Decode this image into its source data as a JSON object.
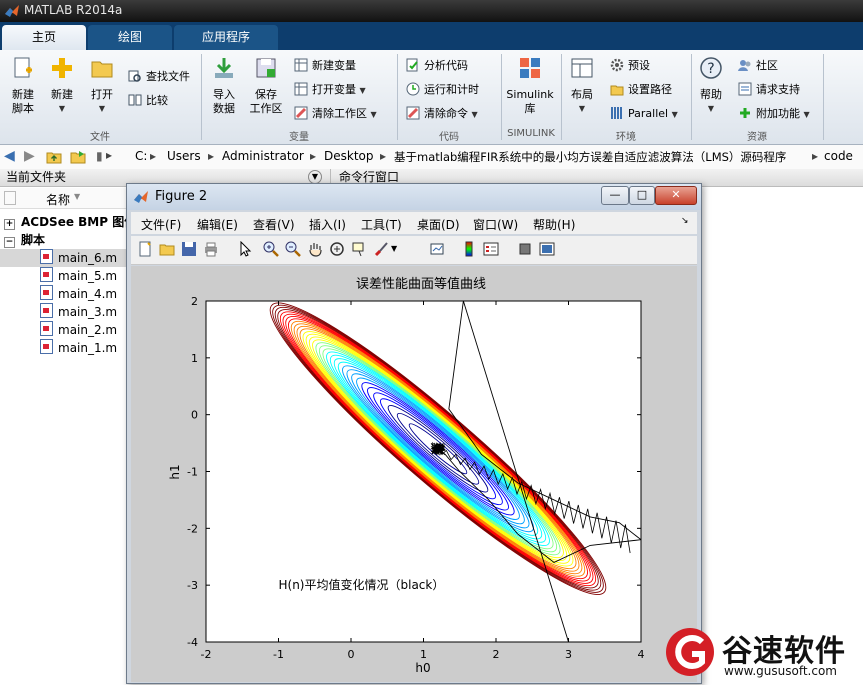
{
  "app": {
    "title": "MATLAB R2014a"
  },
  "tabs": [
    {
      "label": "主页"
    },
    {
      "label": "绘图"
    },
    {
      "label": "应用程序"
    }
  ],
  "ribbon": {
    "file": {
      "new_script": "新建\n脚本",
      "new": "新建",
      "open": "打开",
      "find_files": "查找文件",
      "compare": "比较",
      "section": "文件"
    },
    "variable": {
      "import": "导入\n数据",
      "save_ws": "保存\n工作区",
      "new_var": "新建变量",
      "open_var": "打开变量",
      "clear_ws": "清除工作区",
      "section": "变量"
    },
    "code": {
      "analyze": "分析代码",
      "run_time": "运行和计时",
      "clear_cmd": "清除命令",
      "section": "代码"
    },
    "simulink": {
      "lib": "Simulink\n库",
      "section": "SIMULINK"
    },
    "env": {
      "layout": "布局",
      "prefs": "预设",
      "set_path": "设置路径",
      "parallel": "Parallel",
      "section": "环境"
    },
    "resources": {
      "help": "帮助",
      "community": "社区",
      "request_support": "请求支持",
      "addons": "附加功能",
      "section": "资源"
    }
  },
  "address": {
    "crumbs": [
      "C:",
      "Users",
      "Administrator",
      "Desktop",
      "基于matlab编程FIR系统中的最小均方误差自适应滤波算法（LMS）源码程序",
      "code"
    ]
  },
  "left_panel": {
    "title": "当前文件夹",
    "column_name": "名称",
    "group1": "ACDSee BMP 图像",
    "group2": "脚本",
    "files": [
      "main_6.m",
      "main_5.m",
      "main_4.m",
      "main_3.m",
      "main_2.m",
      "main_1.m"
    ]
  },
  "cmd_panel": {
    "title": "命令行窗口"
  },
  "figure": {
    "title": "Figure 2",
    "menu": [
      "文件(F)",
      "编辑(E)",
      "查看(V)",
      "插入(I)",
      "工具(T)",
      "桌面(D)",
      "窗口(W)",
      "帮助(H)"
    ],
    "win_buttons": {
      "min": "—",
      "max": "□",
      "close": "✕"
    }
  },
  "chart_data": {
    "type": "contour",
    "title": "误差性能曲面等值曲线",
    "xlabel": "h0",
    "ylabel": "h1",
    "xlim": [
      -2,
      4
    ],
    "ylim": [
      -4,
      2
    ],
    "xticks": [
      -2,
      -1,
      0,
      1,
      2,
      3,
      4
    ],
    "yticks": [
      -4,
      -3,
      -2,
      -1,
      0,
      1,
      2
    ],
    "annotation": {
      "text": "H(n)平均值变化情况（black）",
      "x": -1.0,
      "y": -3.0
    },
    "contour_center": [
      1.2,
      -0.6
    ],
    "contour_major_direction": [
      1,
      -1.1
    ],
    "colormap": [
      "#00008f",
      "#0000ff",
      "#00a0ff",
      "#00ffff",
      "#80ff80",
      "#ffff00",
      "#ff8000",
      "#ff0000",
      "#800000"
    ],
    "trajectory_path": [
      [
        1.55,
        2.0
      ],
      [
        1.35,
        0.1
      ],
      [
        1.8,
        -0.7
      ],
      [
        2.3,
        -1.2
      ],
      [
        2.8,
        -1.5
      ],
      [
        3.3,
        -1.8
      ],
      [
        3.7,
        -1.9
      ],
      [
        4.0,
        -2.2
      ],
      [
        3.3,
        -2.3
      ],
      [
        2.8,
        -2.6
      ],
      [
        2.3,
        -2.1
      ],
      [
        1.9,
        -1.5
      ],
      [
        1.5,
        -1.0
      ],
      [
        1.3,
        -0.7
      ],
      [
        1.2,
        -0.6
      ]
    ],
    "trajectory_line": [
      [
        1.55,
        2.0
      ],
      [
        3.0,
        -4.0
      ]
    ],
    "trajectory_color": "#000000"
  },
  "watermark": {
    "brand": "谷速软件",
    "url": "www.gususoft.com"
  }
}
